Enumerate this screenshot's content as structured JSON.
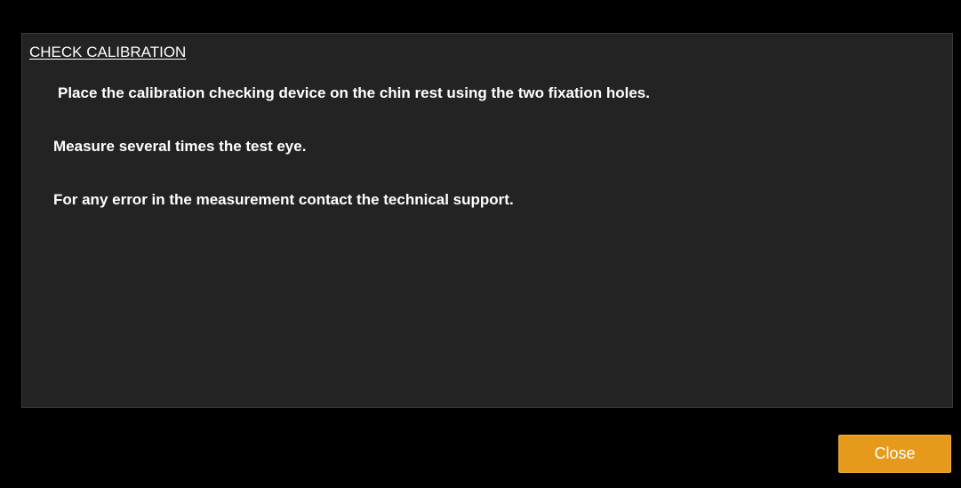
{
  "dialog": {
    "title": "CHECK CALIBRATION",
    "instructions": [
      "Place the calibration checking device on the chin rest using the two fixation holes.",
      "Measure several times the test eye.",
      "For any error in the measurement contact the technical support."
    ],
    "close_label": "Close"
  },
  "colors": {
    "background": "#000000",
    "panel": "#232323",
    "accent": "#e69a1c",
    "text": "#ffffff"
  }
}
